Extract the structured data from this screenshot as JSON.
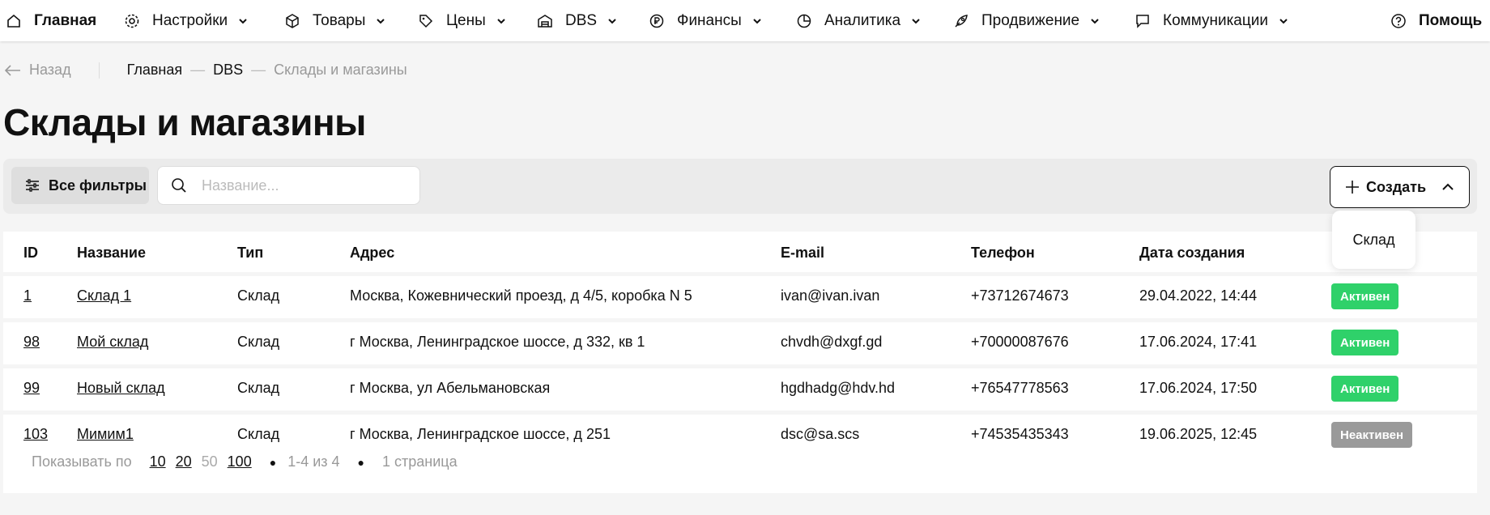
{
  "nav": {
    "items": [
      {
        "label": "Главная",
        "icon": "home-icon"
      },
      {
        "label": "Настройки",
        "icon": "gear-icon"
      },
      {
        "label": "Товары",
        "icon": "box-icon"
      },
      {
        "label": "Цены",
        "icon": "tag-icon"
      },
      {
        "label": "DBS",
        "icon": "warehouse-icon"
      },
      {
        "label": "Финансы",
        "icon": "ruble-icon"
      },
      {
        "label": "Аналитика",
        "icon": "pie-chart-icon"
      },
      {
        "label": "Продвижение",
        "icon": "rocket-icon"
      },
      {
        "label": "Коммуникации",
        "icon": "chat-icon"
      }
    ],
    "help": "Помощь"
  },
  "breadcrumbs": {
    "back": "Назад",
    "items": [
      "Главная",
      "DBS"
    ],
    "current": "Склады и магазины"
  },
  "page_title": "Склады и магазины",
  "toolbar": {
    "filters_label": "Все фильтры",
    "search_placeholder": "Название...",
    "create_label": "Создать"
  },
  "create_menu": {
    "items": [
      "Склад"
    ]
  },
  "table": {
    "columns": [
      "ID",
      "Название",
      "Тип",
      "Адрес",
      "E-mail",
      "Телефон",
      "Дата создания"
    ],
    "rows": [
      {
        "id": "1",
        "name": "Склад 1",
        "type": "Склад",
        "address": "Москва, Кожевнический проезд, д 4/5, коробка N 5",
        "email": "ivan@ivan.ivan",
        "phone": "+73712674673",
        "created": "29.04.2022, 14:44",
        "status": "Активен",
        "active": true
      },
      {
        "id": "98",
        "name": "Мой склад",
        "type": "Склад",
        "address": "г Москва, Ленинградское шоссе, д 332, кв 1",
        "email": "chvdh@dxgf.gd",
        "phone": "+70000087676",
        "created": "17.06.2024, 17:41",
        "status": "Активен",
        "active": true
      },
      {
        "id": "99",
        "name": "Новый склад",
        "type": "Склад",
        "address": "г Москва, ул Абельмановская",
        "email": "hgdhadg@hdv.hd",
        "phone": "+76547778563",
        "created": "17.06.2024, 17:50",
        "status": "Активен",
        "active": true
      },
      {
        "id": "103",
        "name": "Мимим1",
        "type": "Склад",
        "address": "г Москва, Ленинградское шоссе, д 251",
        "email": "dsc@sa.scs",
        "phone": "+74535435343",
        "created": "19.06.2025, 12:45",
        "status": "Неактивен",
        "active": false
      }
    ]
  },
  "pager": {
    "show_by": "Показывать по",
    "sizes": [
      "10",
      "20",
      "50",
      "100"
    ],
    "selected_size": "50",
    "range": "1-4 из 4",
    "pages": "1 страница"
  },
  "colors": {
    "active": "#2fd16a",
    "inactive": "#9a9a9a"
  }
}
